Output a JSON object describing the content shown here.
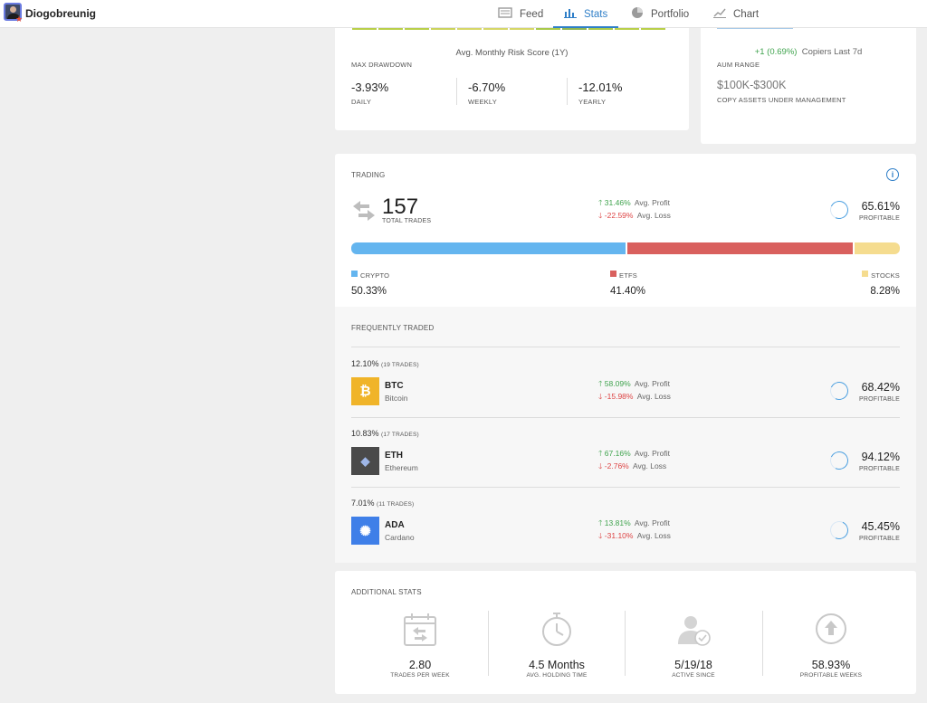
{
  "header": {
    "username": "Diogobreunig",
    "nav": [
      {
        "label": "Feed",
        "icon": "feed-icon"
      },
      {
        "label": "Stats",
        "icon": "stats-icon"
      },
      {
        "label": "Portfolio",
        "icon": "portfolio-icon"
      },
      {
        "label": "Chart",
        "icon": "chart-icon"
      }
    ],
    "active_tab": "Stats"
  },
  "risk": {
    "caption": "Avg. Monthly Risk Score (1Y)",
    "max_drawdown_label": "MAX DRAWDOWN",
    "drawdowns": [
      {
        "value": "-3.93%",
        "label": "DAILY"
      },
      {
        "value": "-6.70%",
        "label": "WEEKLY"
      },
      {
        "value": "-12.01%",
        "label": "YEARLY"
      }
    ]
  },
  "aum": {
    "copiers_change": "+1 (0.69%)",
    "copiers_label": "Copiers Last 7d",
    "aum_range_label": "AUM RANGE",
    "aum_value": "$100K-$300K",
    "aum_caption": "COPY ASSETS UNDER MANAGEMENT"
  },
  "trading": {
    "title": "TRADING",
    "total_trades": "157",
    "total_trades_label": "TOTAL TRADES",
    "avg_profit": "31.46%",
    "avg_profit_label": "Avg. Profit",
    "avg_loss": "-22.59%",
    "avg_loss_label": "Avg. Loss",
    "profitable_pct": "65.61%",
    "profitable_label": "PROFITABLE",
    "breakdown": [
      {
        "label": "CRYPTO",
        "value": "50.33%",
        "share": 50.33,
        "color": "#64b5ef"
      },
      {
        "label": "ETFS",
        "value": "41.40%",
        "share": 41.4,
        "color": "#d9605e"
      },
      {
        "label": "STOCKS",
        "value": "8.28%",
        "share": 8.28,
        "color": "#f5dc8f"
      }
    ]
  },
  "frequently_traded": {
    "title": "FREQUENTLY TRADED",
    "items": [
      {
        "pct": "12.10%",
        "trades": "(19 TRADES)",
        "symbol": "BTC",
        "name": "Bitcoin",
        "avg_profit": "58.09%",
        "avg_loss": "-15.98%",
        "profitable": "68.42%",
        "profit_label": "Avg. Profit",
        "loss_label": "Avg. Loss",
        "profitable_label": "PROFITABLE",
        "icon_color": "#f0b429",
        "icon_glyph": "₿"
      },
      {
        "pct": "10.83%",
        "trades": "(17 TRADES)",
        "symbol": "ETH",
        "name": "Ethereum",
        "avg_profit": "67.16%",
        "avg_loss": "-2.76%",
        "profitable": "94.12%",
        "profit_label": "Avg. Profit",
        "loss_label": "Avg. Loss",
        "profitable_label": "PROFITABLE",
        "icon_color": "#4a4a4a",
        "icon_glyph": "◆"
      },
      {
        "pct": "7.01%",
        "trades": "(11 TRADES)",
        "symbol": "ADA",
        "name": "Cardano",
        "avg_profit": "13.81%",
        "avg_loss": "-31.10%",
        "profitable": "45.45%",
        "profit_label": "Avg. Profit",
        "loss_label": "Avg. Loss",
        "profitable_label": "PROFITABLE",
        "icon_color": "#3f7fe8",
        "icon_glyph": "✺"
      }
    ]
  },
  "additional_stats": {
    "title": "ADDITIONAL STATS",
    "items": [
      {
        "value": "2.80",
        "label": "TRADES PER WEEK",
        "icon": "calendar-icon"
      },
      {
        "value": "4.5 Months",
        "label": "AVG. HOLDING TIME",
        "icon": "stopwatch-icon"
      },
      {
        "value": "5/19/18",
        "label": "ACTIVE SINCE",
        "icon": "user-check-icon"
      },
      {
        "value": "58.93%",
        "label": "PROFITABLE WEEKS",
        "icon": "arrow-up-circle-icon"
      }
    ]
  }
}
